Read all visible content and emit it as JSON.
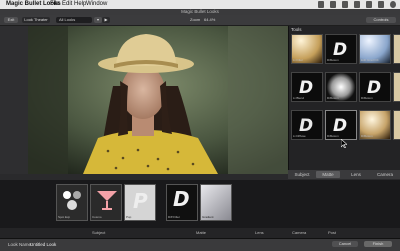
{
  "menubar": {
    "app_name": "Magic Bullet Looks",
    "items": [
      "File",
      "Edit",
      "Help",
      "Window"
    ]
  },
  "window": {
    "title": "Magic Bullet Looks"
  },
  "toolbar": {
    "exit_label": "Exit",
    "look_theater_label": "Look Theater",
    "looks_dropdown": "All Looks",
    "zoom_label": "Zoom",
    "zoom_value": "64.4%",
    "controls_label": "Controls"
  },
  "right_panel": {
    "title": "Tools",
    "tiles": [
      {
        "label": "Lt Filter"
      },
      {
        "label": "Diffusion"
      },
      {
        "label": "Edit Grad Filt"
      },
      {
        "label": "Chromatic Aber"
      },
      {
        "label": "Lt Blend"
      },
      {
        "label": "Diffusion"
      },
      {
        "label": "Diffusion"
      },
      {
        "label": "Chromatic Aber"
      },
      {
        "label": "Lt Diffuse"
      },
      {
        "label": "Diffusion"
      },
      {
        "label": "Diffusion"
      },
      {
        "label": "Chromatic Aber"
      }
    ],
    "tabs": [
      "Subject",
      "Matte",
      "Lens",
      "Camera"
    ]
  },
  "stack": {
    "slots": [
      {
        "label": "Spot Exp"
      },
      {
        "label": "Cosmo"
      },
      {
        "label": "Pop"
      },
      {
        "label": "Diff Filter"
      },
      {
        "label": "Gradient"
      }
    ],
    "sections": [
      "Subject",
      "Matte",
      "Lens",
      "Camera",
      "Post"
    ]
  },
  "status": {
    "look_name_label": "Look Name:",
    "look_name_value": "Untitled Look",
    "cancel_label": "Cancel",
    "finish_label": "Finish"
  },
  "colors": {
    "accent": "#ffffff",
    "panel": "#232325",
    "menubar": "#e7e7e7"
  }
}
